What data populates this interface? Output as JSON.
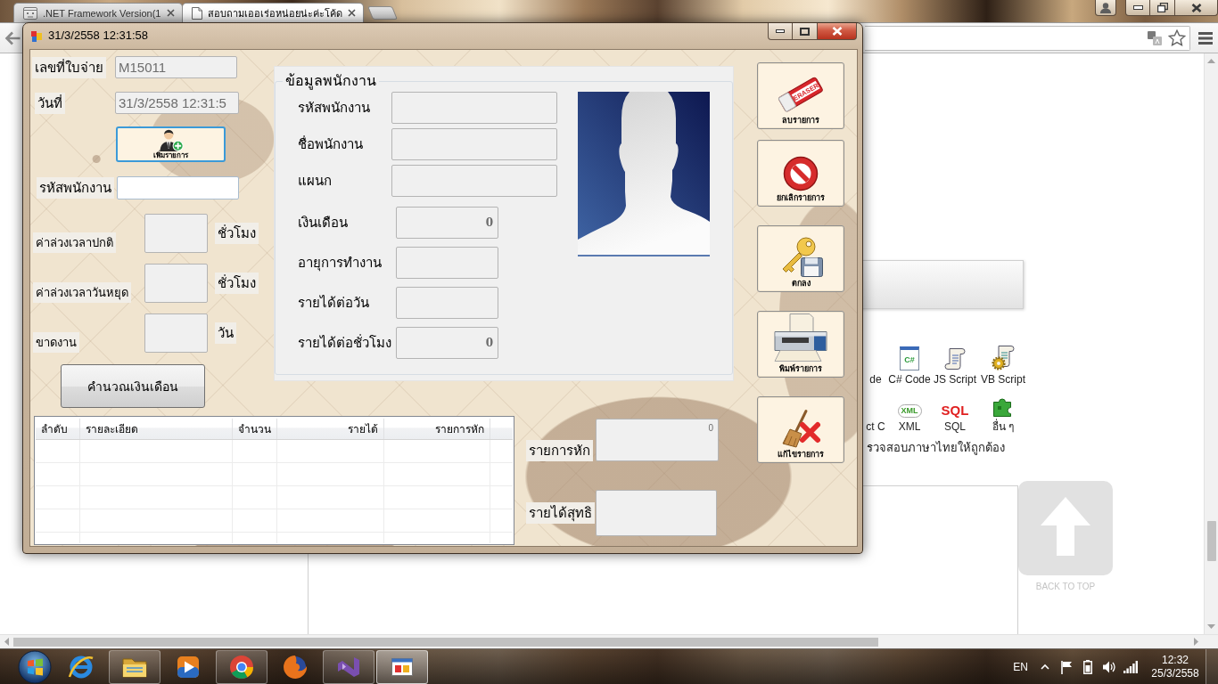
{
  "browser": {
    "tabs": [
      {
        "label": ".NET Framework Version(1",
        "selected": false
      },
      {
        "label": "สอบถามเออเร่อหน่อยน่ะค่ะโค้ด",
        "selected": true
      }
    ],
    "page": {
      "links": [
        {
          "label": "de",
          "kind": "cut"
        },
        {
          "label": "C# Code",
          "kind": "file",
          "badge": "C#"
        },
        {
          "label": "JS Script",
          "kind": "script"
        },
        {
          "label": "VB Script",
          "kind": "gear-script"
        },
        {
          "label": "ct C",
          "kind": "cut"
        },
        {
          "label": "XML",
          "kind": "tag",
          "badge": "XML"
        },
        {
          "label": "SQL",
          "kind": "word",
          "badge": "SQL"
        },
        {
          "label": "อื่น ๆ",
          "kind": "puzzle"
        }
      ],
      "note": "รวจสอบภาษาไทยให้ถูกต้อง",
      "back_to_top": "BACK TO TOP"
    }
  },
  "app_window": {
    "title": "31/3/2558 12:31:58",
    "slip": [
      {
        "label": "เลขที่ใบจ่าย",
        "value": "M15011",
        "disabled": true
      },
      {
        "label": "วันที่",
        "value": "31/3/2558 12:31:5",
        "disabled": true
      }
    ],
    "add_button": {
      "label": "เพิ่มรายการ",
      "focused": true
    },
    "employee_id": {
      "label": "รหัสพนักงาน",
      "disabled": false
    },
    "time_fields": [
      {
        "label": "ค่าล่วงเวลาปกติ",
        "unit": "ชั่วโมง",
        "disabled": true
      },
      {
        "label": "ค่าล่วงเวลาวันหยุด",
        "unit": "ชั่วโมง",
        "disabled": true
      },
      {
        "label": "ขาดงาน",
        "unit": "วัน",
        "disabled": true
      }
    ],
    "calculate_button": "คำนวณเงินเดือน",
    "employee_info": {
      "title": "ข้อมูลพนักงาน",
      "text_fields": [
        {
          "label": "รหัสพนักงาน",
          "disabled": true
        },
        {
          "label": "ชื่อพนักงาน",
          "disabled": true
        },
        {
          "label": "แผนก",
          "disabled": true
        }
      ],
      "number_fields": [
        {
          "label": "เงินเดือน",
          "value": "0",
          "disabled": true
        },
        {
          "label": "อายุการทำงาน",
          "disabled": true
        },
        {
          "label": "รายได้ต่อวัน",
          "disabled": true
        },
        {
          "label": "รายได้ต่อชั่วโมง",
          "value": "0",
          "disabled": true
        }
      ]
    },
    "actions": [
      {
        "label": "ลบรายการ",
        "kind": "eraser",
        "icon_text": "ERASER"
      },
      {
        "label": "ยกเลิกรายการ",
        "kind": "cancel"
      },
      {
        "label": "ตกลง",
        "kind": "save"
      },
      {
        "label": "พิมพ์รายการ",
        "kind": "print"
      },
      {
        "label": "แก้ไขรายการ",
        "kind": "clear"
      }
    ],
    "table": {
      "columns": [
        {
          "label": "ลำดับ"
        },
        {
          "label": "รายละเอียด"
        },
        {
          "label": "จำนวน"
        },
        {
          "label": "รายได้"
        },
        {
          "label": "รายการหัก"
        }
      ]
    },
    "totals": [
      {
        "label": "รายการหัก",
        "value": "0",
        "disabled": true
      },
      {
        "label": "รายได้สุทธิ",
        "disabled": true
      }
    ]
  },
  "taskbar": {
    "apps": [
      {
        "kind": "ie",
        "running": false,
        "selected": false
      },
      {
        "kind": "explorer",
        "running": true,
        "selected": false
      },
      {
        "kind": "media",
        "running": false,
        "selected": false
      },
      {
        "kind": "chrome",
        "running": true,
        "selected": false
      },
      {
        "kind": "firefox",
        "running": false,
        "selected": false
      },
      {
        "kind": "studio",
        "running": true,
        "selected": false
      },
      {
        "kind": "forms",
        "running": true,
        "selected": true
      }
    ],
    "language": "EN",
    "time": "12:32",
    "date": "25/3/2558"
  }
}
